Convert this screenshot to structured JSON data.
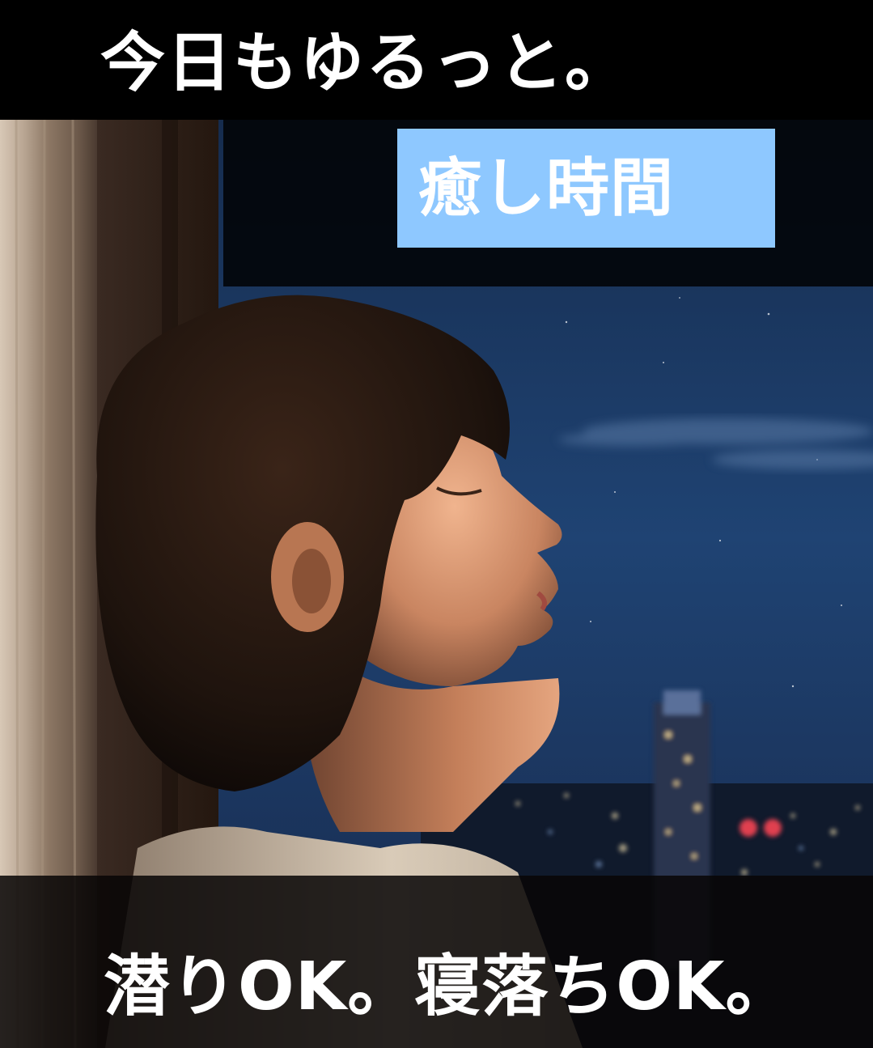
{
  "headline": {
    "text": "今日もゆるっと。"
  },
  "label": {
    "text": "癒し時間"
  },
  "caption": {
    "text": "潜りOK。寝落ちOK。"
  },
  "colors": {
    "label_background": "#8ec8ff",
    "band_background": "#000000",
    "text": "#ffffff",
    "night_sky": "#1c3a66"
  },
  "scene": {
    "description_icons": [
      "woman-profile-illustration",
      "city-night-skyline",
      "curtain"
    ]
  }
}
